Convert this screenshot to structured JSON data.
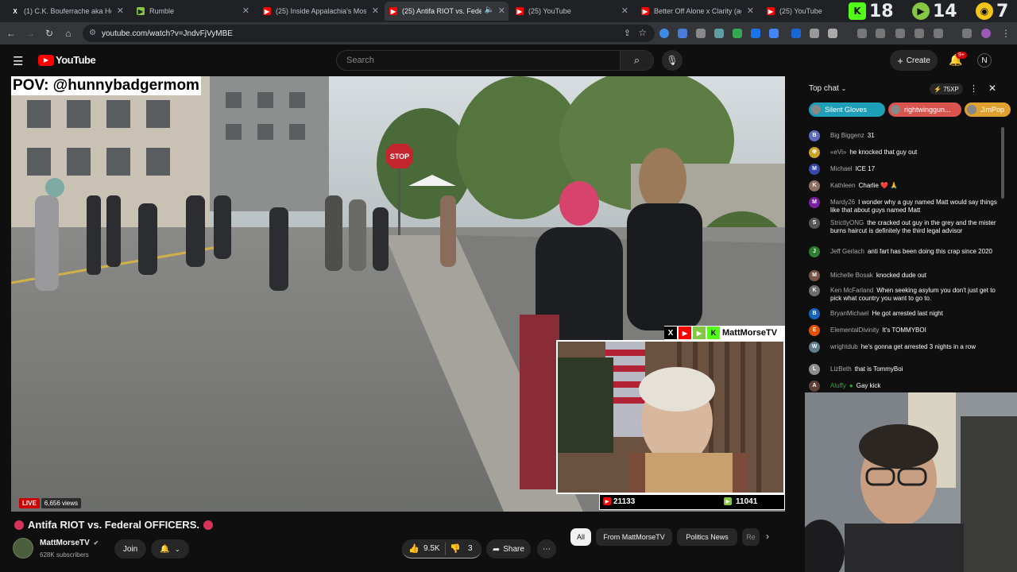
{
  "browser": {
    "tabs": [
      {
        "title": "(1) C.K. Bouferrache aka Honey",
        "favicon": "x-icon",
        "active": false
      },
      {
        "title": "Rumble",
        "favicon": "rumble-icon",
        "active": false
      },
      {
        "title": "(25) Inside Appalachia's Most S",
        "favicon": "youtube-icon",
        "active": false
      },
      {
        "title": "(25) Antifa RIOT vs. Fede",
        "favicon": "youtube-icon",
        "active": true
      },
      {
        "title": "(25) YouTube",
        "favicon": "youtube-icon",
        "active": false
      },
      {
        "title": "Better Off Alone x Clarity (agai",
        "favicon": "youtube-icon",
        "active": false
      },
      {
        "title": "(25) YouTube",
        "favicon": "youtube-icon",
        "active": false
      }
    ],
    "overlay_counts": {
      "kick": "18",
      "rumble": "14",
      "extra": "7"
    },
    "url": "youtube.com/watch?v=JndvFjVyMBE"
  },
  "youtube": {
    "logo_text": "YouTube",
    "search_placeholder": "Search",
    "create_label": "Create",
    "notification_badge": "9+",
    "avatar_letter": "N"
  },
  "video": {
    "pov_caption": "POV: @hunnybadgermom",
    "live_label": "LIVE",
    "views": "6,656 views",
    "streamer_name": "MattMorseTV",
    "youtube_count": "21133",
    "rumble_count": "11041",
    "stop_sign": "STOP"
  },
  "meta": {
    "title": "Antifa RIOT vs. Federal OFFICERS.",
    "channel_name": "MattMorseTV",
    "subscribers": "628K subscribers",
    "join_label": "Join",
    "likes": "9.5K",
    "dislikes": "3",
    "share_label": "Share",
    "chips": [
      "All",
      "From MattMorseTV",
      "Politics News",
      "Re"
    ]
  },
  "chat": {
    "header": "Top chat",
    "points": "75XP",
    "ticker": [
      {
        "name": "Silent Gloves",
        "color": "#1e9fb8"
      },
      {
        "name": "rightwinggun...",
        "color": "#d9534f"
      },
      {
        "name": "JimPop",
        "color": "#e0a030"
      }
    ],
    "messages": [
      {
        "author": "Big Biggenz",
        "text": "31",
        "avatar": "B",
        "color": "#5c6bc0"
      },
      {
        "author": "«eVi»",
        "text": "he knocked that guy out",
        "avatar": "☢",
        "color": "#c9a227"
      },
      {
        "author": "Michael",
        "text": "ICE 17",
        "avatar": "M",
        "color": "#3949ab"
      },
      {
        "author": "Kathleen",
        "text": "Charlie ❤️ 🙏",
        "avatar": "K",
        "color": "#8d6e63"
      },
      {
        "author": "Mardy26",
        "text": "I wonder why a guy named Matt would say things like that about guys named Matt",
        "avatar": "M",
        "color": "#7b1fa2"
      },
      {
        "author": "StrictlyONG",
        "text": "the cracked out guy in the grey and the mister burns haircut is definitely the third legal advisor",
        "avatar": "S",
        "color": "#555"
      },
      {
        "author": "Jeff Gerlach",
        "text": "anti fart has been doing this crap since 2020",
        "avatar": "J",
        "color": "#2e7d32"
      },
      {
        "author": "Michelle Bosak",
        "text": "knocked dude out",
        "avatar": "M",
        "color": "#795548"
      },
      {
        "author": "Ken McFarland",
        "text": "When seeking asylum you don't just get to pick what country you want to go to.",
        "avatar": "K",
        "color": "#6d6d6d"
      },
      {
        "author": "BryanMichael",
        "text": "He got arrested last night",
        "avatar": "B",
        "color": "#1565c0"
      },
      {
        "author": "ElementalDivinity",
        "text": "It's TOMMYBOI",
        "avatar": "E",
        "color": "#e65100"
      },
      {
        "author": "wrightdub",
        "text": "he's gonna get arrested 3 nights in a row",
        "avatar": "W",
        "color": "#607d8b"
      },
      {
        "author": "LizBeth",
        "text": "that is TommyBoi",
        "avatar": "L",
        "color": "#8e8e8e"
      },
      {
        "author": "Aluffy",
        "text": "Gay kick",
        "avatar": "A",
        "color": "#5d4037",
        "member": true
      }
    ]
  }
}
